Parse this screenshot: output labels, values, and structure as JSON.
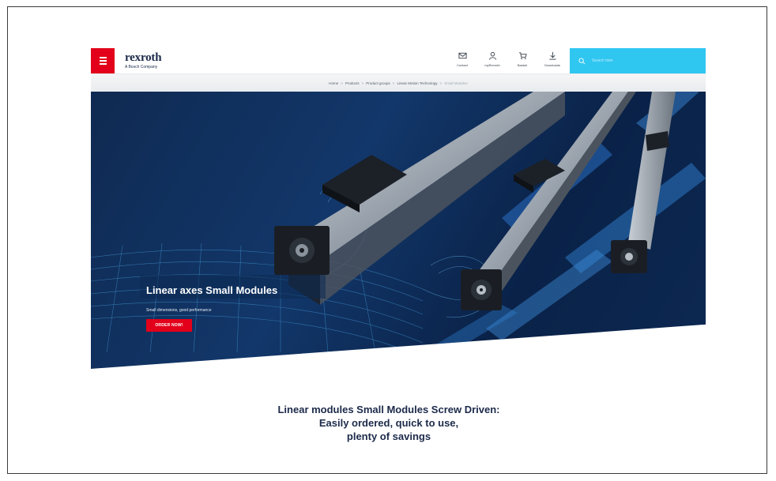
{
  "header": {
    "menu_icon": "hamburger-icon",
    "logo_word": "rexroth",
    "logo_sub": "A Bosch Company",
    "nav": [
      {
        "icon": "mail-icon",
        "label": "Contact"
      },
      {
        "icon": "user-icon",
        "label": "myRexroth"
      },
      {
        "icon": "cart-icon",
        "label": "Basket"
      },
      {
        "icon": "download-icon",
        "label": "Downloads"
      }
    ],
    "search_placeholder": "Search item",
    "colors": {
      "menu": "#e2001a",
      "search": "#2fc6f0"
    }
  },
  "breadcrumb": {
    "items": [
      "Home",
      "Products",
      "Product groups",
      "Linear Motion Technology",
      "Small Modules"
    ],
    "separator": ">"
  },
  "hero": {
    "title": "Linear axes Small Modules",
    "subtitle": "Small dimensions, good performance",
    "cta": "ORDER NOW!"
  },
  "headline": {
    "lines": [
      "Linear modules Small Modules Screw Driven:",
      "Easily ordered, quick to use,",
      "plenty of savings"
    ]
  }
}
